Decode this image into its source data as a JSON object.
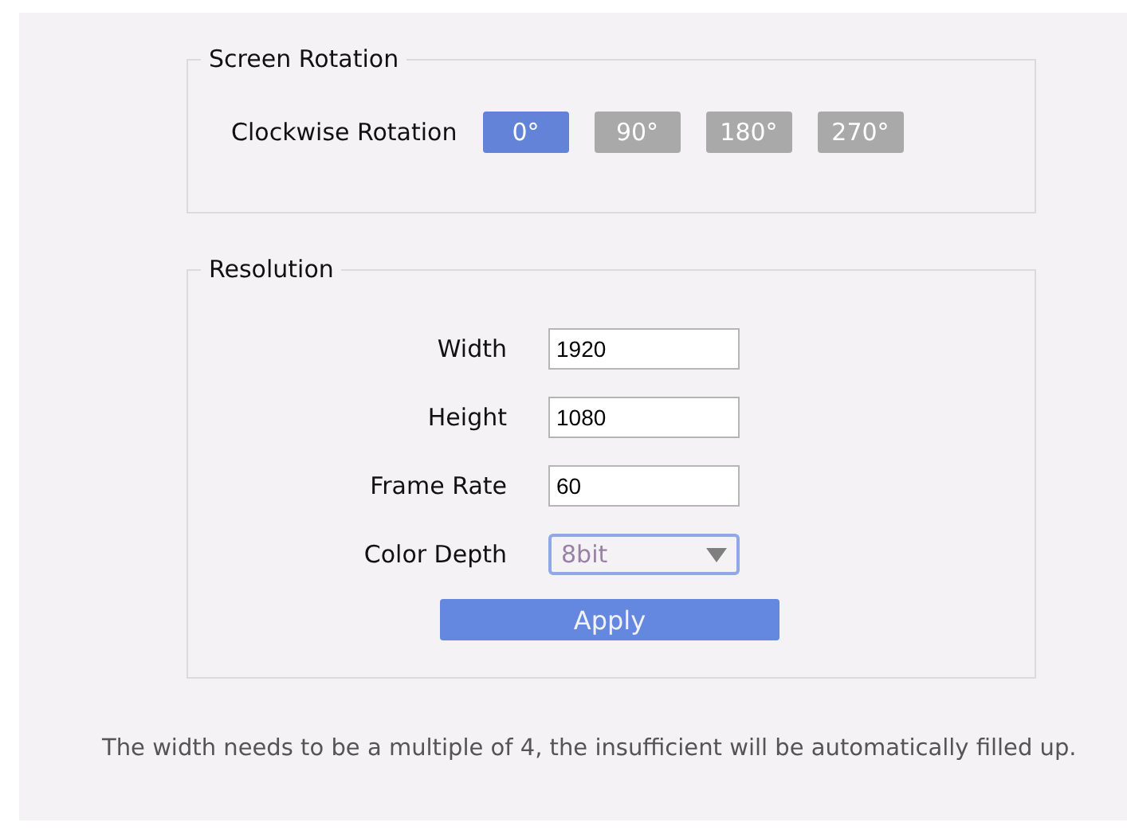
{
  "rotation": {
    "title": "Screen Rotation",
    "label": "Clockwise Rotation",
    "options": [
      {
        "label": "0°",
        "selected": true
      },
      {
        "label": "90°",
        "selected": false
      },
      {
        "label": "180°",
        "selected": false
      },
      {
        "label": "270°",
        "selected": false
      }
    ]
  },
  "resolution": {
    "title": "Resolution",
    "fields": [
      {
        "kind": "text",
        "label": "Width",
        "value": "1920"
      },
      {
        "kind": "text",
        "label": "Height",
        "value": "1080"
      },
      {
        "kind": "text",
        "label": "Frame Rate",
        "value": "60"
      },
      {
        "kind": "select",
        "label": "Color Depth",
        "value": "8bit"
      }
    ],
    "apply": "Apply"
  },
  "note": "The width needs to be a multiple of 4, the insufficient will be automatically filled up."
}
